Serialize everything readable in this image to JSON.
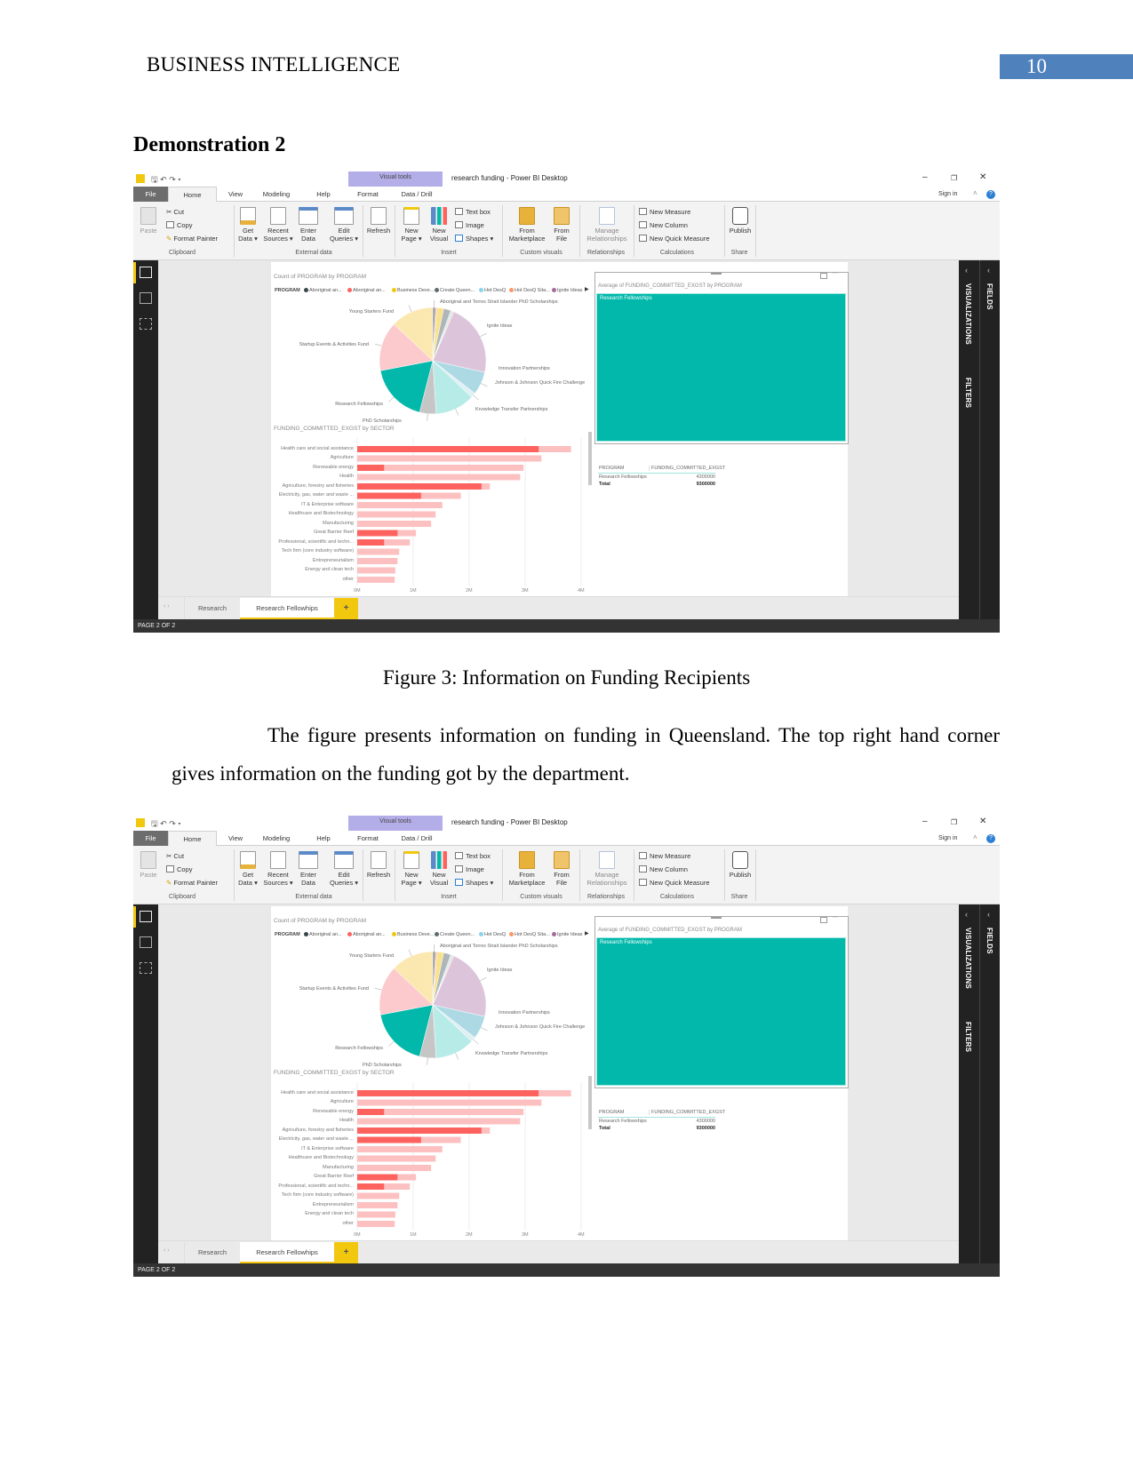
{
  "document": {
    "header_title": "BUSINESS INTELLIGENCE",
    "page_number": "10",
    "heading": "Demonstration 2",
    "figure_caption": "Figure 3: Information on Funding Recipients",
    "paragraph": "The figure presents information on funding in Queensland. The top right hand corner gives information on the funding got by the department."
  },
  "powerbi": {
    "window_title": "research funding - Power BI Desktop",
    "contextual_tab": "Visual tools",
    "window_controls": {
      "minimize": "–",
      "restore": "❐",
      "close": "✕"
    },
    "tabs": [
      "File",
      "Home",
      "View",
      "Modeling",
      "Help",
      "Format",
      "Data / Drill"
    ],
    "sign_in": "Sign in",
    "ribbon": {
      "paste": "Paste",
      "cut": "Cut",
      "copy": "Copy",
      "format_painter": "Format Painter",
      "get_data": "Get\nData ▾",
      "recent_sources": "Recent\nSources ▾",
      "enter_data": "Enter\nData",
      "edit_queries": "Edit\nQueries ▾",
      "refresh": "Refresh",
      "new_page": "New\nPage ▾",
      "new_visual": "New\nVisual",
      "text_box": "Text box",
      "image": "Image",
      "shapes": "Shapes ▾",
      "from_marketplace": "From\nMarketplace",
      "from_file": "From\nFile",
      "manage_relationships": "Manage\nRelationships",
      "new_measure": "New Measure",
      "new_column": "New Column",
      "new_quick_measure": "New Quick Measure",
      "publish": "Publish"
    },
    "groups": [
      "Clipboard",
      "External data",
      "Insert",
      "Custom visuals",
      "Relationships",
      "Calculations",
      "Share"
    ],
    "right_panes": {
      "visualizations": "VISUALIZATIONS",
      "filters": "FILTERS",
      "fields": "FIELDS"
    },
    "card": {
      "title": "Average of FUNDING_COMMITTED_EXGST by PROGRAM",
      "label": "Research Fellowships",
      "color": "#01b8aa"
    },
    "table": {
      "headers": [
        "PROGRAM",
        "FUNDING_COMMITTED_EXGST"
      ],
      "rows": [
        [
          "Research Fellowships",
          "4300000"
        ]
      ],
      "total": [
        "Total",
        "9300000"
      ]
    },
    "page_tabs": [
      "Research",
      "Research Fellowhips"
    ],
    "active_page_tab": "Research Fellowhips",
    "add_page": "+",
    "status": "PAGE 2 OF 2"
  },
  "chart_data": [
    {
      "type": "pie",
      "title": "Count of PROGRAM by PROGRAM",
      "legend_title": "PROGRAM",
      "legend_placement": "top",
      "legend": [
        {
          "label": "Aboriginal an...",
          "color": "#374649"
        },
        {
          "label": "Aboriginal an...",
          "color": "#fd625e"
        },
        {
          "label": "Business Deve...",
          "color": "#f2c80f"
        },
        {
          "label": "Create Queen...",
          "color": "#5f6b6d"
        },
        {
          "label": "Hot DesQ",
          "color": "#8ad4eb"
        },
        {
          "label": "Hot DesQ Sita...",
          "color": "#fe9666"
        },
        {
          "label": "Ignite Ideas",
          "color": "#a66999"
        }
      ],
      "slices": [
        {
          "label": "Aboriginal and Torres Strait Islander PhD Scholarships",
          "value": 0.8,
          "color": "#8a9496"
        },
        {
          "label": "",
          "value": 0.5,
          "color": "#fdb1af"
        },
        {
          "label": "",
          "value": 2,
          "color": "#f8e38a"
        },
        {
          "label": "",
          "value": 2.2,
          "color": "#b0b6b7"
        },
        {
          "label": "",
          "value": 0.6,
          "color": "#c5eaf5"
        },
        {
          "label": "",
          "value": 0.4,
          "color": "#ffcbb3"
        },
        {
          "label": "Ignite Ideas",
          "value": 22,
          "color": "#dcc5da"
        },
        {
          "label": "Innovation Partnerships",
          "value": 7,
          "color": "#acd9e4"
        },
        {
          "label": "Johnson & Johnson Quick Fire Challenge",
          "value": 1.5,
          "color": "#dff0f3"
        },
        {
          "label": "Knowledge Transfer Partnerships",
          "value": 12,
          "color": "#b6ebe7"
        },
        {
          "label": "PhD Scholarships",
          "value": 5,
          "color": "#c6c6c6"
        },
        {
          "label": "Research Fellowships",
          "value": 18,
          "color": "#01b8aa"
        },
        {
          "label": "Startup Events & Activities Fund",
          "value": 15,
          "color": "#fcc9cc"
        },
        {
          "label": "Young Starters Fund",
          "value": 13,
          "color": "#fbe8b0"
        }
      ]
    },
    {
      "type": "bar",
      "orientation": "horizontal",
      "title": "FUNDING_COMMITTED_EXGST by SECTOR",
      "categories": [
        "Health care and social assistance",
        "Agriculture",
        "Renewable energy",
        "Health",
        "Agriculture, forestry and fisheries",
        "Electricity, gas, water and waste ...",
        "IT & Enterprise software",
        "Healthcare and Biotechnology",
        "Manufacturing",
        "Great Barrier Reef",
        "Professional, scientific and techn...",
        "Tech firm (core industry software)",
        "Entrepreneurialism",
        "Energy and clean tech",
        "other"
      ],
      "values_total": [
        3.82,
        3.29,
        2.97,
        2.91,
        2.37,
        1.85,
        1.52,
        1.4,
        1.32,
        1.05,
        0.94,
        0.75,
        0.72,
        0.68,
        0.67
      ],
      "values_highlighted": [
        3.24,
        0,
        0.48,
        0,
        2.22,
        1.14,
        0,
        0,
        0,
        0.72,
        0.48,
        0,
        0,
        0,
        0
      ],
      "unit": "M",
      "xticks": [
        "0M",
        "1M",
        "2M",
        "3M",
        "4M"
      ],
      "xlim": [
        0,
        4
      ],
      "colors": {
        "total": "#fdc0c0",
        "highlighted": "#fd625e"
      },
      "grid": true
    }
  ]
}
